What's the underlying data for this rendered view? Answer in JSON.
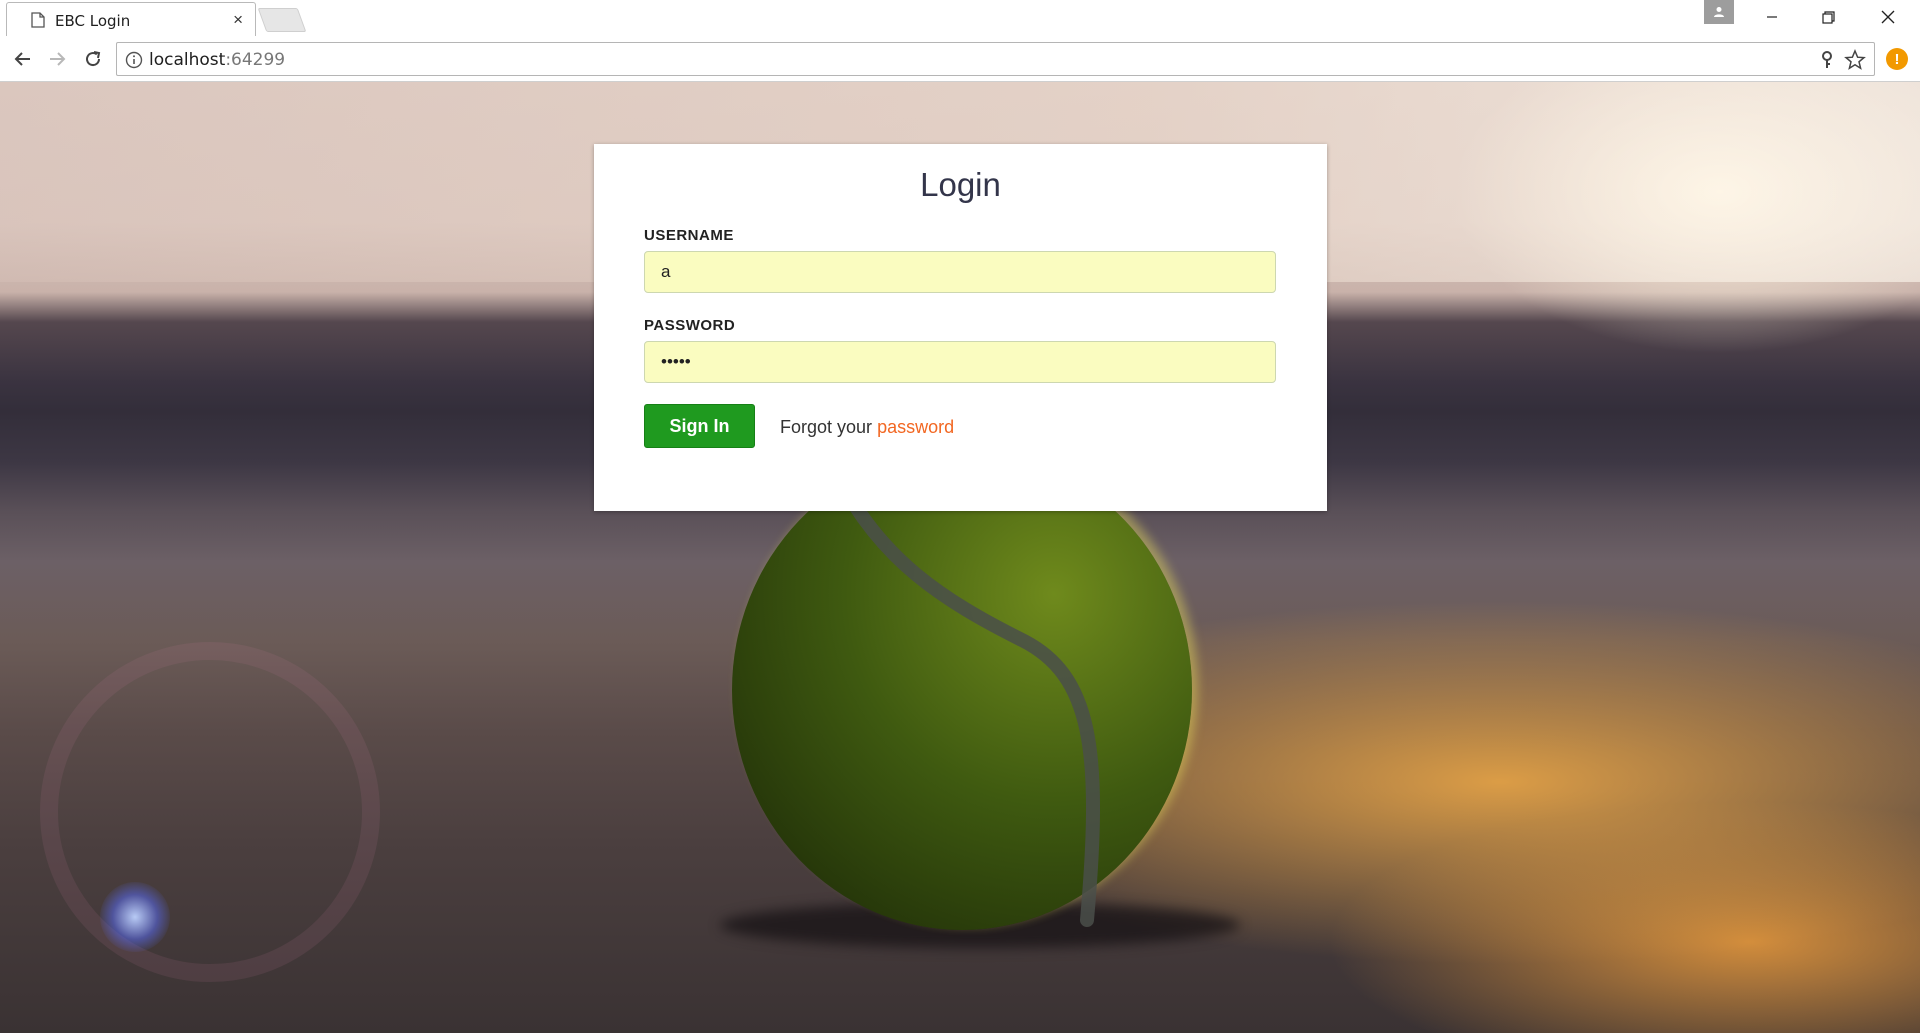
{
  "browser": {
    "tab_title": "EBC Login",
    "tab_close": "×",
    "url_host": "localhost",
    "url_port": ":64299"
  },
  "login": {
    "title": "Login",
    "username_label": "USERNAME",
    "username_value": "a",
    "password_label": "PASSWORD",
    "password_value": "•••••",
    "signin_label": "Sign In",
    "forgot_text": "Forgot your",
    "forgot_link": "password"
  },
  "colors": {
    "signin_button": "#1f9a1f",
    "link": "#f26722",
    "autofill_input": "#fafcc0"
  },
  "icons": [
    "page-icon",
    "close-icon",
    "profile-icon",
    "minimize-icon",
    "restore-icon",
    "window-close-icon",
    "back-icon",
    "forward-icon",
    "reload-icon",
    "info-icon",
    "key-icon",
    "star-icon",
    "alert-icon"
  ]
}
